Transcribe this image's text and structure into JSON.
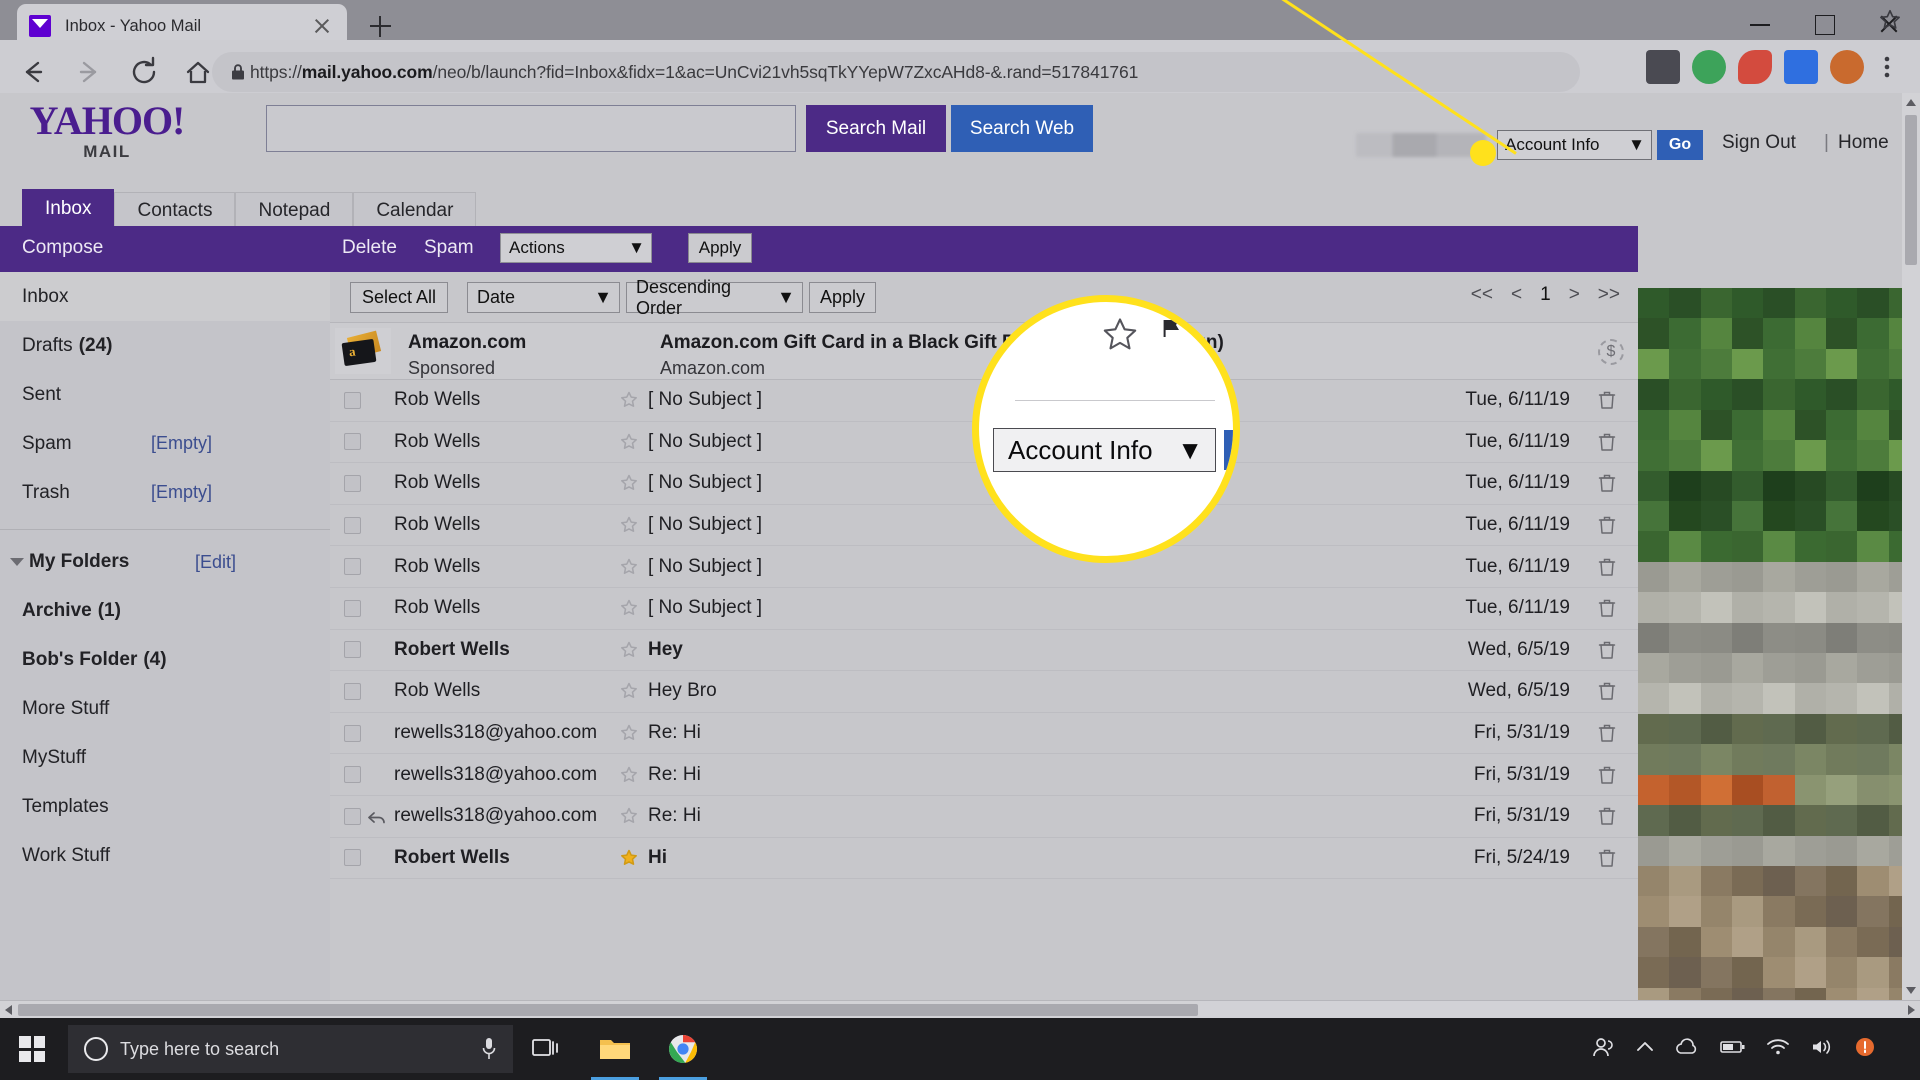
{
  "browser": {
    "tab_title": "Inbox - Yahoo Mail",
    "url_scheme": "https://",
    "url_host": "mail.yahoo.com",
    "url_path": "/neo/b/launch?fid=Inbox&fidx=1&ac=UnCvi21vh5sqTkYYepW7ZxcAHd8-&.rand=517841761",
    "new_tab_label": "+",
    "icons": {
      "back": "back-arrow-icon",
      "forward": "forward-arrow-icon",
      "reload": "reload-icon",
      "home": "home-icon",
      "lock": "lock-icon",
      "star": "bookmark-star-icon",
      "menu": "chrome-menu-icon"
    }
  },
  "yahoo": {
    "logo_main": "YAHOO!",
    "logo_sub": "MAIL",
    "search_value": "",
    "search_placeholder": "",
    "search_mail_label": "Search Mail",
    "search_web_label": "Search Web",
    "account_info_label": "Account Info",
    "go_label": "Go",
    "sign_out_label": "Sign Out",
    "pipe": "|",
    "home_label": "Home",
    "tabs": [
      {
        "label": "Inbox",
        "active": true
      },
      {
        "label": "Contacts",
        "active": false
      },
      {
        "label": "Notepad",
        "active": false
      },
      {
        "label": "Calendar",
        "active": false
      }
    ],
    "actionbar": {
      "compose": "Compose",
      "delete": "Delete",
      "spam": "Spam",
      "actions_selected": "Actions",
      "apply": "Apply"
    },
    "sidebar": [
      {
        "label": "Inbox",
        "count": "",
        "badge": "",
        "selected": true,
        "bold": false
      },
      {
        "label": "Drafts",
        "count": "(24)",
        "badge": "",
        "selected": false,
        "bold": false
      },
      {
        "label": "Sent",
        "count": "",
        "badge": "",
        "selected": false,
        "bold": false
      },
      {
        "label": "Spam",
        "count": "",
        "badge": "[Empty]",
        "selected": false,
        "bold": false
      },
      {
        "label": "Trash",
        "count": "",
        "badge": "[Empty]",
        "selected": false,
        "bold": false
      }
    ],
    "my_folders": {
      "label": "My Folders",
      "edit": "[Edit]"
    },
    "folders": [
      {
        "label": "Archive",
        "count": "(1)",
        "bold": true
      },
      {
        "label": "Bob's Folder",
        "count": "(4)",
        "bold": true
      },
      {
        "label": "More Stuff",
        "count": "",
        "bold": false
      },
      {
        "label": "MyStuff",
        "count": "",
        "bold": false
      },
      {
        "label": "Templates",
        "count": "",
        "bold": false
      },
      {
        "label": "Work Stuff",
        "count": "",
        "bold": false
      }
    ],
    "list_toolbar": {
      "select_all": "Select All",
      "sort_field": "Date",
      "sort_order": "Descending Order",
      "apply": "Apply",
      "pager": [
        "<<",
        "<",
        "1",
        ">",
        ">>"
      ],
      "current_page": "1"
    },
    "ad_row": {
      "from_name": "Amazon.com",
      "from_sub": "Sponsored",
      "subject": "Amazon.com Gift Card in a Black Gift Box (Black Card Design)",
      "subject_sub": "Amazon.com",
      "badge_icon": "sponsored-dollar-icon"
    },
    "messages": [
      {
        "from": "Rob Wells",
        "subject": "[ No Subject ]",
        "date": "Tue, 6/11/19",
        "unread": false,
        "starred": false,
        "replied": false
      },
      {
        "from": "Rob Wells",
        "subject": "[ No Subject ]",
        "date": "Tue, 6/11/19",
        "unread": false,
        "starred": false,
        "replied": false
      },
      {
        "from": "Rob Wells",
        "subject": "[ No Subject ]",
        "date": "Tue, 6/11/19",
        "unread": false,
        "starred": false,
        "replied": false
      },
      {
        "from": "Rob Wells",
        "subject": "[ No Subject ]",
        "date": "Tue, 6/11/19",
        "unread": false,
        "starred": false,
        "replied": false
      },
      {
        "from": "Rob Wells",
        "subject": "[ No Subject ]",
        "date": "Tue, 6/11/19",
        "unread": false,
        "starred": false,
        "replied": false
      },
      {
        "from": "Rob Wells",
        "subject": "[ No Subject ]",
        "date": "Tue, 6/11/19",
        "unread": false,
        "starred": false,
        "replied": false
      },
      {
        "from": "Robert Wells",
        "subject": "Hey",
        "date": "Wed, 6/5/19",
        "unread": true,
        "starred": false,
        "replied": false
      },
      {
        "from": "Rob Wells",
        "subject": "Hey Bro",
        "date": "Wed, 6/5/19",
        "unread": false,
        "starred": false,
        "replied": false
      },
      {
        "from": "rewells318@yahoo.com",
        "subject": "Re: Hi",
        "date": "Fri, 5/31/19",
        "unread": false,
        "starred": false,
        "replied": false
      },
      {
        "from": "rewells318@yahoo.com",
        "subject": "Re: Hi",
        "date": "Fri, 5/31/19",
        "unread": false,
        "starred": false,
        "replied": false
      },
      {
        "from": "rewells318@yahoo.com",
        "subject": "Re: Hi",
        "date": "Fri, 5/31/19",
        "unread": false,
        "starred": false,
        "replied": true
      },
      {
        "from": "Robert Wells",
        "subject": "Hi",
        "date": "Fri, 5/24/19",
        "unread": true,
        "starred": true,
        "replied": false
      }
    ]
  },
  "callout": {
    "account_info_label": "Account Info",
    "dropdown_caret": "▼",
    "highlight_color": "#ffe11c"
  },
  "taskbar": {
    "search_placeholder": "Type here to search",
    "items": [
      {
        "name": "task-view",
        "icon": "task-view-icon"
      },
      {
        "name": "file-explorer",
        "icon": "folder-icon"
      },
      {
        "name": "google-chrome",
        "icon": "chrome-icon"
      }
    ],
    "tray": [
      "people-icon",
      "show-hidden-icons-icon",
      "onedrive-icon",
      "battery-icon",
      "wifi-icon",
      "volume-icon",
      "action-center-icon"
    ]
  }
}
